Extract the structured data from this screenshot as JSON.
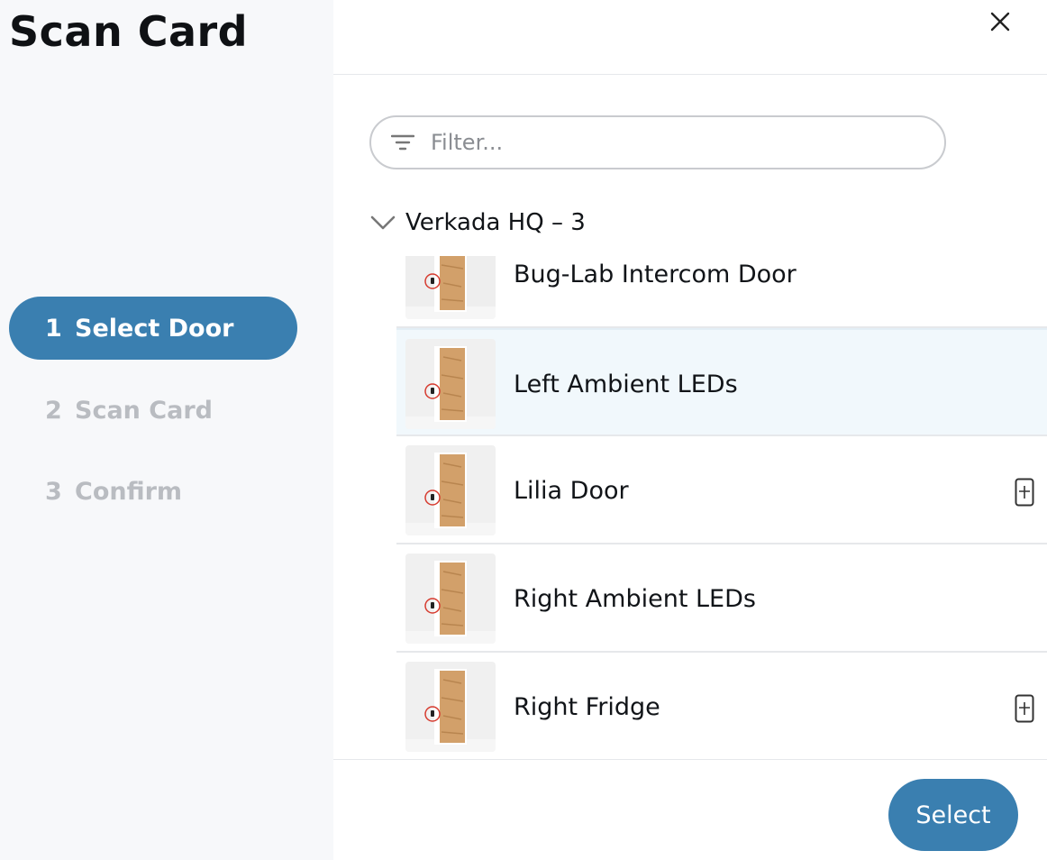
{
  "sidebar": {
    "title": "Scan Card",
    "steps": [
      {
        "number": "1",
        "label": "Select Door",
        "active": true
      },
      {
        "number": "2",
        "label": "Scan Card",
        "active": false
      },
      {
        "number": "3",
        "label": "Confirm",
        "active": false
      }
    ]
  },
  "header": {
    "close_icon": "close-icon"
  },
  "filter": {
    "placeholder": "Filter...",
    "value": "",
    "icon": "filter-icon"
  },
  "group": {
    "label": "Verkada HQ – 3",
    "expanded": true,
    "icon": "chevron-down-icon"
  },
  "doors": [
    {
      "name": "Bug-Lab Intercom Door",
      "selected": false,
      "has_reader_icon": false
    },
    {
      "name": "Left Ambient LEDs",
      "selected": true,
      "has_reader_icon": false
    },
    {
      "name": "Lilia Door",
      "selected": false,
      "has_reader_icon": true
    },
    {
      "name": "Right Ambient LEDs",
      "selected": false,
      "has_reader_icon": false
    },
    {
      "name": "Right Fridge",
      "selected": false,
      "has_reader_icon": true
    }
  ],
  "footer": {
    "select_label": "Select"
  },
  "colors": {
    "accent": "#3a7fb0",
    "sidebar_bg": "#f7f8fa",
    "selected_row_bg": "#f1f8fc",
    "inactive_step": "#b9bcc1"
  }
}
